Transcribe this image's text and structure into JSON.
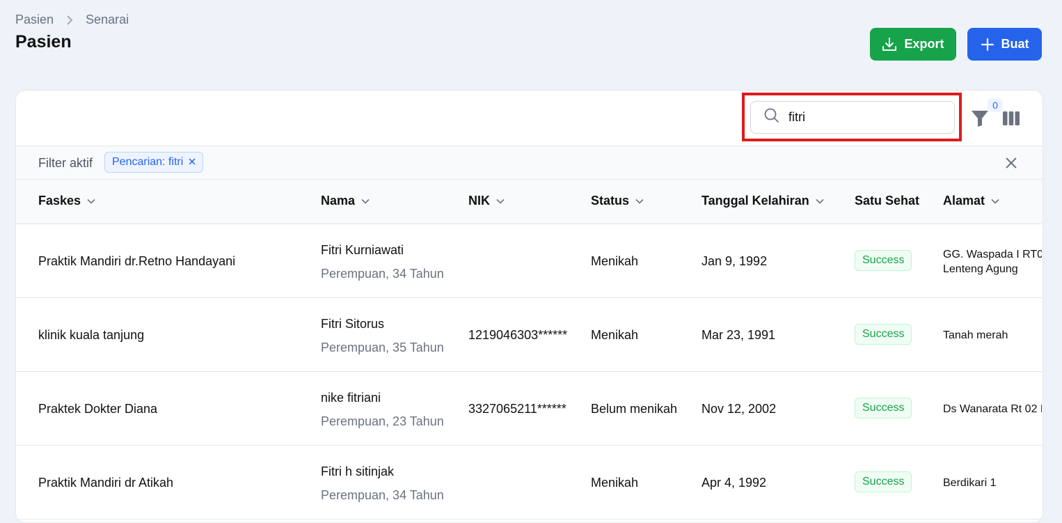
{
  "breadcrumb": {
    "parent": "Pasien",
    "current": "Senarai"
  },
  "page": {
    "title": "Pasien"
  },
  "actions": {
    "export_label": "Export",
    "create_label": "Buat"
  },
  "search": {
    "value": "fitri"
  },
  "filter": {
    "count": "0",
    "active_label": "Filter aktif",
    "chip_label": "Pencarian: fitri"
  },
  "columns": {
    "faskes": "Faskes",
    "nama": "Nama",
    "nik": "NIK",
    "status": "Status",
    "birth_date": "Tanggal Kelahiran",
    "satu_sehat": "Satu Sehat",
    "alamat": "Alamat"
  },
  "rows": [
    {
      "faskes": "Praktik Mandiri dr.Retno Handayani",
      "name": "Fitri Kurniawati",
      "subtitle": "Perempuan, 34 Tahun",
      "nik": "",
      "status": "Menikah",
      "birth_date": "Jan 9, 1992",
      "satu_sehat": "Success",
      "address_line1": "GG. Waspada I RT0",
      "address_line2": "Lenteng Agung"
    },
    {
      "faskes": "klinik kuala tanjung",
      "name": "Fitri Sitorus",
      "subtitle": "Perempuan, 35 Tahun",
      "nik": "1219046303******",
      "status": "Menikah",
      "birth_date": "Mar 23, 1991",
      "satu_sehat": "Success",
      "address_line1": "Tanah merah",
      "address_line2": ""
    },
    {
      "faskes": "Praktek Dokter Diana",
      "name": "nike fitriani",
      "subtitle": "Perempuan, 23 Tahun",
      "nik": "3327065211******",
      "status": "Belum menikah",
      "birth_date": "Nov 12, 2002",
      "satu_sehat": "Success",
      "address_line1": "Ds Wanarata Rt 02 R",
      "address_line2": ""
    },
    {
      "faskes": "Praktik Mandiri dr Atikah",
      "name": "Fitri h sitinjak",
      "subtitle": "Perempuan, 34 Tahun",
      "nik": "",
      "status": "Menikah",
      "birth_date": "Apr 4, 1992",
      "satu_sehat": "Success",
      "address_line1": "Berdikari 1",
      "address_line2": ""
    }
  ]
}
